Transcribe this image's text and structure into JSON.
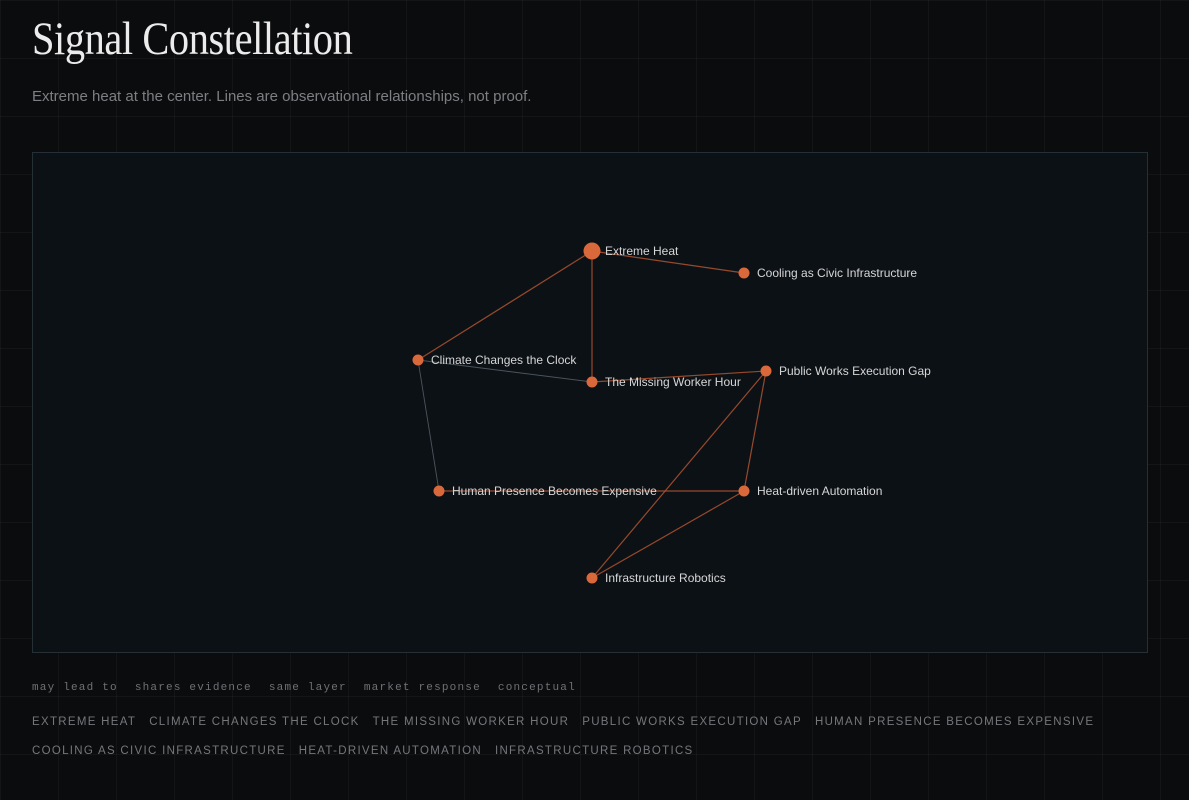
{
  "header": {
    "title": "Signal Constellation",
    "subtitle": "Extreme heat at the center. Lines are observational relationships, not proof."
  },
  "colors": {
    "node": "#d9683b",
    "edge": "#b0532f",
    "edge_gray": "#66707a",
    "label": "#d6d6d6"
  },
  "graph": {
    "nodes": [
      {
        "id": "extreme-heat",
        "label": "Extreme Heat",
        "center": true
      },
      {
        "id": "cooling",
        "label": "Cooling as Civic Infrastructure"
      },
      {
        "id": "climate-clock",
        "label": "Climate Changes the Clock"
      },
      {
        "id": "missing-hour",
        "label": "The Missing Worker Hour"
      },
      {
        "id": "public-works",
        "label": "Public Works Execution Gap"
      },
      {
        "id": "human-presence",
        "label": "Human Presence Becomes Expensive"
      },
      {
        "id": "heat-automation",
        "label": "Heat-driven Automation"
      },
      {
        "id": "robotics",
        "label": "Infrastructure Robotics"
      }
    ],
    "edges": [
      {
        "source": "extreme-heat",
        "target": "cooling",
        "tone": "accent"
      },
      {
        "source": "extreme-heat",
        "target": "climate-clock",
        "tone": "accent"
      },
      {
        "source": "extreme-heat",
        "target": "missing-hour",
        "tone": "accent"
      },
      {
        "source": "climate-clock",
        "target": "missing-hour",
        "tone": "gray"
      },
      {
        "source": "climate-clock",
        "target": "human-presence",
        "tone": "gray"
      },
      {
        "source": "missing-hour",
        "target": "public-works",
        "tone": "accent"
      },
      {
        "source": "public-works",
        "target": "heat-automation",
        "tone": "accent"
      },
      {
        "source": "public-works",
        "target": "robotics",
        "tone": "accent"
      },
      {
        "source": "human-presence",
        "target": "heat-automation",
        "tone": "accent"
      },
      {
        "source": "heat-automation",
        "target": "robotics",
        "tone": "accent"
      }
    ]
  },
  "legend": [
    "may lead to",
    "shares evidence",
    "same layer",
    "market response",
    "conceptual"
  ],
  "signals": [
    "Extreme Heat",
    "Climate Changes the Clock",
    "The Missing Worker Hour",
    "Public Works Execution Gap",
    "Human Presence Becomes Expensive",
    "Cooling as Civic Infrastructure",
    "Heat-driven Automation",
    "Infrastructure Robotics"
  ]
}
